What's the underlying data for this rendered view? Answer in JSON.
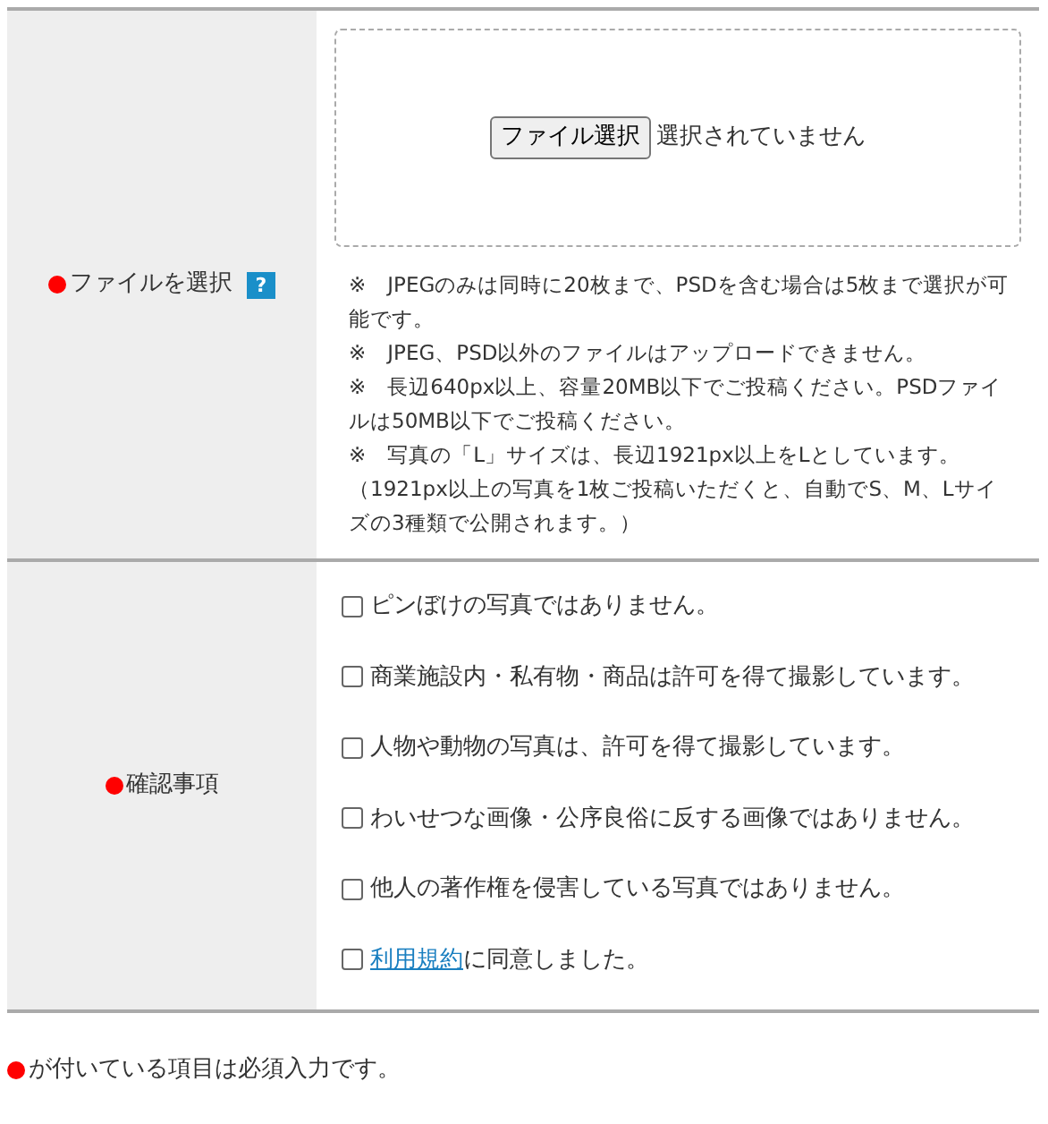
{
  "rows": [
    {
      "kind": "file",
      "label": "ファイルを選択",
      "required": true,
      "help": "?",
      "button": "ファイル選択",
      "status": "選択されていません",
      "notes": [
        "※　JPEGのみは同時に20枚まで、PSDを含む場合は5枚まで選択が可能です。",
        "※　JPEG、PSD以外のファイルはアップロードできません。",
        "※　長辺640px以上、容量20MB以下でご投稿ください。PSDファイルは50MB以下でご投稿ください。",
        "※　写真の「L」サイズは、長辺1921px以上をLとしています。",
        "（1921px以上の写真を1枚ご投稿いただくと、自動でS、M、Lサイズの3種類で公開されます。）"
      ]
    },
    {
      "kind": "checks",
      "label": "確認事項",
      "required": true,
      "items": [
        {
          "text": "ピンぼけの写真ではありません。",
          "checked": false
        },
        {
          "text": "商業施設内・私有物・商品は許可を得て撮影しています。",
          "checked": false
        },
        {
          "text": "人物や動物の写真は、許可を得て撮影しています。",
          "checked": false
        },
        {
          "text": "わいせつな画像・公序良俗に反する画像ではありません。",
          "checked": false
        },
        {
          "text": "他人の著作権を侵害している写真ではありません。",
          "checked": false
        },
        {
          "link": "利用規約",
          "text": "に同意しました。",
          "checked": false
        }
      ]
    }
  ],
  "legend": "が付いている項目は必須入力です。"
}
